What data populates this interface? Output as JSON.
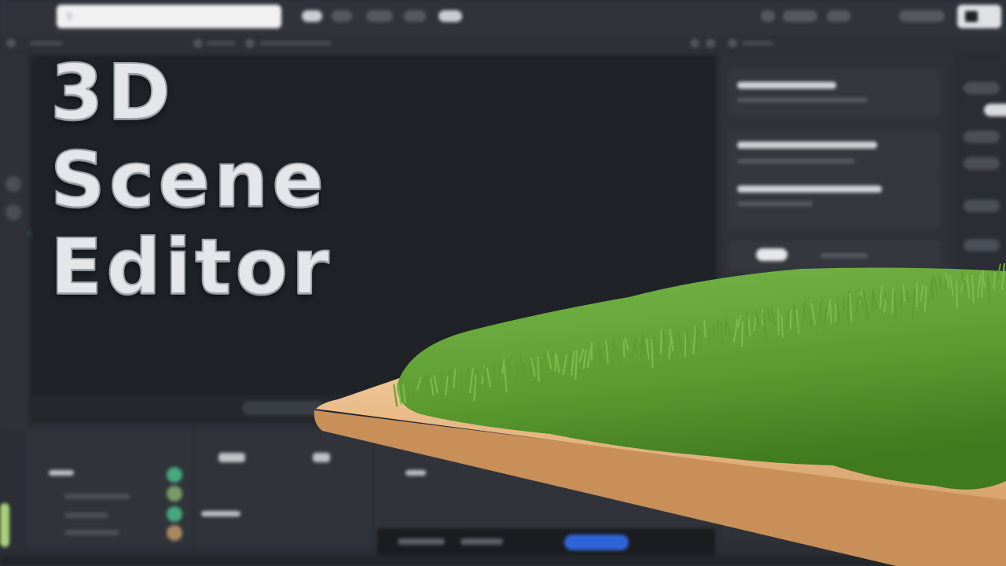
{
  "headline": {
    "lines": [
      "3D",
      "Scene",
      "Editor"
    ]
  },
  "search": {
    "placeholder": ""
  },
  "colors": {
    "background": "#2b2e35",
    "viewport": "#1f2227",
    "accent_blue": "#2f64d9",
    "accent_green": "#3f8f5c",
    "grass": "#5f9e34",
    "board": "#e9b988"
  },
  "icons": {
    "search": "search-icon",
    "logo": "app-logo-icon"
  }
}
